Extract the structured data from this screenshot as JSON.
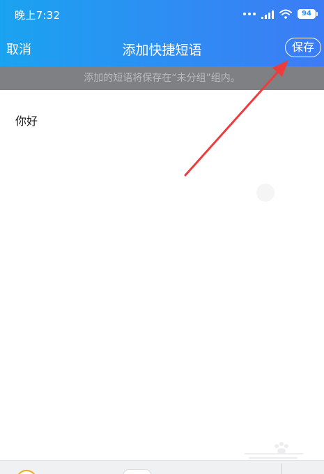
{
  "status_bar": {
    "time": "晚上7:32",
    "battery": "94"
  },
  "nav": {
    "cancel_label": "取消",
    "title": "添加快捷短语",
    "save_label": "保存"
  },
  "notice": {
    "text": "添加的短语将保存在“未分组”组内。"
  },
  "editor": {
    "text": "你好"
  },
  "colors": {
    "header_start": "#1aa3f0",
    "header_end": "#3c7cf5",
    "notice_bg": "#7f8083",
    "annotation_arrow": "#ee3b3b"
  }
}
